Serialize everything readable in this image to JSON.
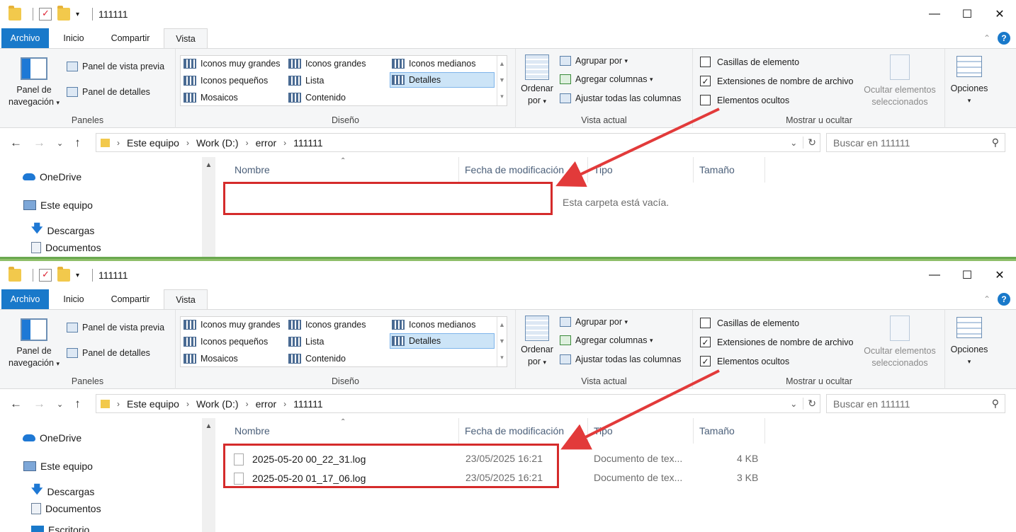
{
  "windows": [
    {
      "title": "111111",
      "tabs": [
        "Archivo",
        "Inicio",
        "Compartir",
        "Vista"
      ],
      "ribbon": {
        "panes": {
          "nav_label_1": "Panel de",
          "nav_label_2": "navegación",
          "preview": "Panel de vista previa",
          "details": "Panel de detalles",
          "group": "Paneles"
        },
        "layout": {
          "items": [
            "Iconos muy grandes",
            "Iconos grandes",
            "Iconos medianos",
            "Iconos pequeños",
            "Lista",
            "Detalles",
            "Mosaicos",
            "Contenido"
          ],
          "selected": "Detalles",
          "group": "Diseño"
        },
        "view": {
          "sort_1": "Ordenar",
          "sort_2": "por",
          "group_by": "Agrupar por",
          "add_columns": "Agregar columnas",
          "fit_columns": "Ajustar todas las columnas",
          "group": "Vista actual"
        },
        "show": {
          "checkboxes": "Casillas de elemento",
          "extensions": "Extensiones de nombre de archivo",
          "hidden": "Elementos ocultos",
          "hide_selected_1": "Ocultar elementos",
          "hide_selected_2": "seleccionados",
          "options": "Opciones",
          "group": "Mostrar u ocultar",
          "checkboxes_checked": false,
          "extensions_checked": true,
          "hidden_checked": false
        }
      },
      "address": {
        "crumbs": [
          "Este equipo",
          "Work (D:)",
          "error",
          "111111"
        ],
        "search_placeholder": "Buscar en 111111"
      },
      "tree": [
        "OneDrive",
        "Este equipo",
        "Descargas",
        "Documentos"
      ],
      "columns": [
        "Nombre",
        "Fecha de modificación",
        "Tipo",
        "Tamaño"
      ],
      "empty_message": "Esta carpeta está vacía.",
      "files": []
    },
    {
      "title": "111111",
      "tabs": [
        "Archivo",
        "Inicio",
        "Compartir",
        "Vista"
      ],
      "ribbon": {
        "panes": {
          "nav_label_1": "Panel de",
          "nav_label_2": "navegación",
          "preview": "Panel de vista previa",
          "details": "Panel de detalles",
          "group": "Paneles"
        },
        "layout": {
          "items": [
            "Iconos muy grandes",
            "Iconos grandes",
            "Iconos medianos",
            "Iconos pequeños",
            "Lista",
            "Detalles",
            "Mosaicos",
            "Contenido"
          ],
          "selected": "Detalles",
          "group": "Diseño"
        },
        "view": {
          "sort_1": "Ordenar",
          "sort_2": "por",
          "group_by": "Agrupar por",
          "add_columns": "Agregar columnas",
          "fit_columns": "Ajustar todas las columnas",
          "group": "Vista actual"
        },
        "show": {
          "checkboxes": "Casillas de elemento",
          "extensions": "Extensiones de nombre de archivo",
          "hidden": "Elementos ocultos",
          "hide_selected_1": "Ocultar elementos",
          "hide_selected_2": "seleccionados",
          "options": "Opciones",
          "group": "Mostrar u ocultar",
          "checkboxes_checked": false,
          "extensions_checked": true,
          "hidden_checked": true
        }
      },
      "address": {
        "crumbs": [
          "Este equipo",
          "Work (D:)",
          "error",
          "111111"
        ],
        "search_placeholder": "Buscar en 111111"
      },
      "tree": [
        "OneDrive",
        "Este equipo",
        "Descargas",
        "Documentos",
        "Escritorio"
      ],
      "columns": [
        "Nombre",
        "Fecha de modificación",
        "Tipo",
        "Tamaño"
      ],
      "empty_message": "",
      "files": [
        {
          "name": "2025-05-20 00_22_31.log",
          "date": "23/05/2025 16:21",
          "type": "Documento de tex...",
          "size": "4 KB"
        },
        {
          "name": "2025-05-20 01_17_06.log",
          "date": "23/05/2025 16:21",
          "type": "Documento de tex...",
          "size": "3 KB"
        }
      ]
    }
  ],
  "colors": {
    "accent": "#1979ca",
    "annotation_red": "#d52b2b",
    "selection": "#cce4f7"
  }
}
